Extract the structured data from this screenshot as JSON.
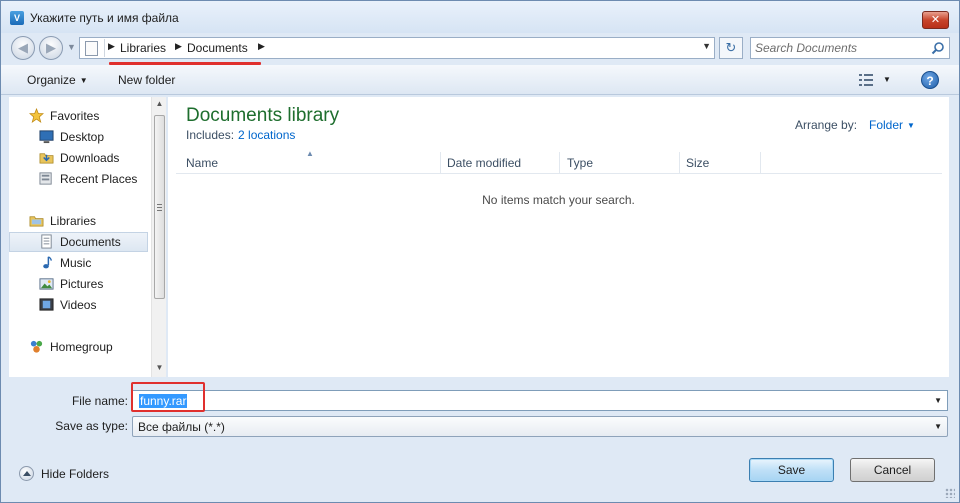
{
  "window": {
    "title": "Укажите путь и имя файла",
    "close_glyph": "✕"
  },
  "address_bar": {
    "breadcrumbs": [
      "Libraries",
      "Documents"
    ],
    "arrow": "▶",
    "search_placeholder": "Search Documents"
  },
  "toolbar": {
    "organize_label": "Organize",
    "new_folder_label": "New folder",
    "help_glyph": "?"
  },
  "nav_pane": {
    "favorites_label": "Favorites",
    "favorites": [
      "Desktop",
      "Downloads",
      "Recent Places"
    ],
    "libraries_label": "Libraries",
    "libraries": [
      "Documents",
      "Music",
      "Pictures",
      "Videos"
    ],
    "selected": "Documents",
    "homegroup_label": "Homegroup"
  },
  "main": {
    "library_title": "Documents library",
    "includes_label": "Includes:",
    "includes_link": "2 locations",
    "arrange_label": "Arrange by:",
    "arrange_value": "Folder",
    "columns": [
      "Name",
      "Date modified",
      "Type",
      "Size"
    ],
    "empty_message": "No items match your search."
  },
  "form": {
    "file_name_label": "File name:",
    "file_name_value": "funny.rar",
    "save_type_label": "Save as type:",
    "save_type_value": "Все файлы (*.*)"
  },
  "footer": {
    "hide_folders_label": "Hide Folders",
    "save_label": "Save",
    "cancel_label": "Cancel"
  },
  "colors": {
    "accent_red": "#e0302e",
    "library_title": "#1e6e2e",
    "link_blue": "#0066cc",
    "selection_blue": "#3399ff"
  }
}
